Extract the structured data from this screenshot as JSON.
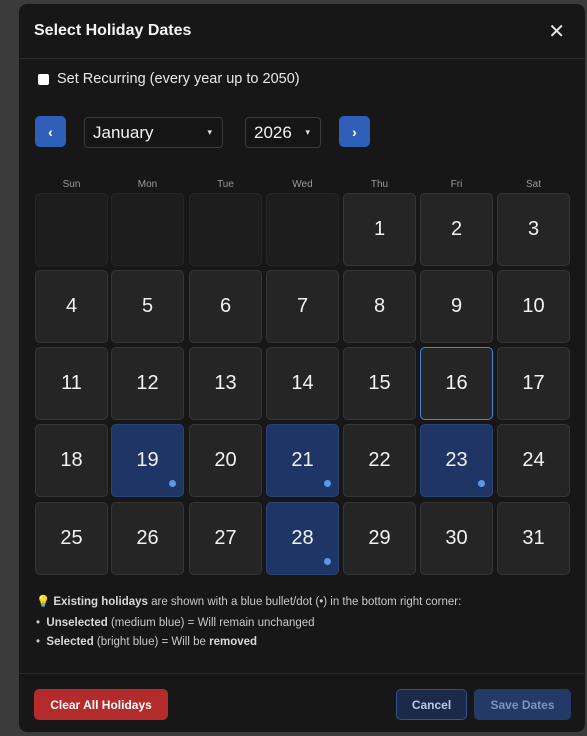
{
  "dialog": {
    "title": "Select Holiday Dates",
    "close_glyph": "✕",
    "recurring_label": "Set Recurring (every year up to 2050)",
    "recurring_checked": false
  },
  "nav": {
    "prev_glyph": "‹",
    "next_glyph": "›",
    "month": "January",
    "year": "2026",
    "caret": "▾"
  },
  "weekdays": [
    "Sun",
    "Mon",
    "Tue",
    "Wed",
    "Thu",
    "Fri",
    "Sat"
  ],
  "calendar": {
    "leading_empty": 4,
    "days": [
      "1",
      "2",
      "3",
      "4",
      "5",
      "6",
      "7",
      "8",
      "9",
      "10",
      "11",
      "12",
      "13",
      "14",
      "15",
      "16",
      "17",
      "18",
      "19",
      "20",
      "21",
      "22",
      "23",
      "24",
      "25",
      "26",
      "27",
      "28",
      "29",
      "30",
      "31"
    ],
    "existing_holidays": [
      "19",
      "21",
      "23",
      "28"
    ],
    "highlighted_day": "16"
  },
  "info": {
    "line1_bold": "Existing holidays",
    "line1_rest": " are shown with a blue bullet/dot (•) in the bottom right corner:",
    "line2_bold": "Unselected",
    "line2_rest": " (medium blue) = Will remain unchanged",
    "line3_bold": "Selected",
    "line3_mid": " (bright blue) = Will be ",
    "line3_end": "removed",
    "bullet": "•"
  },
  "footer": {
    "clear_label": "Clear All Holidays",
    "cancel_label": "Cancel",
    "save_label": "Save Dates"
  },
  "colors": {
    "accent": "#2f5fb8",
    "holiday_bg": "#1f3565",
    "danger": "#b32b2b"
  }
}
